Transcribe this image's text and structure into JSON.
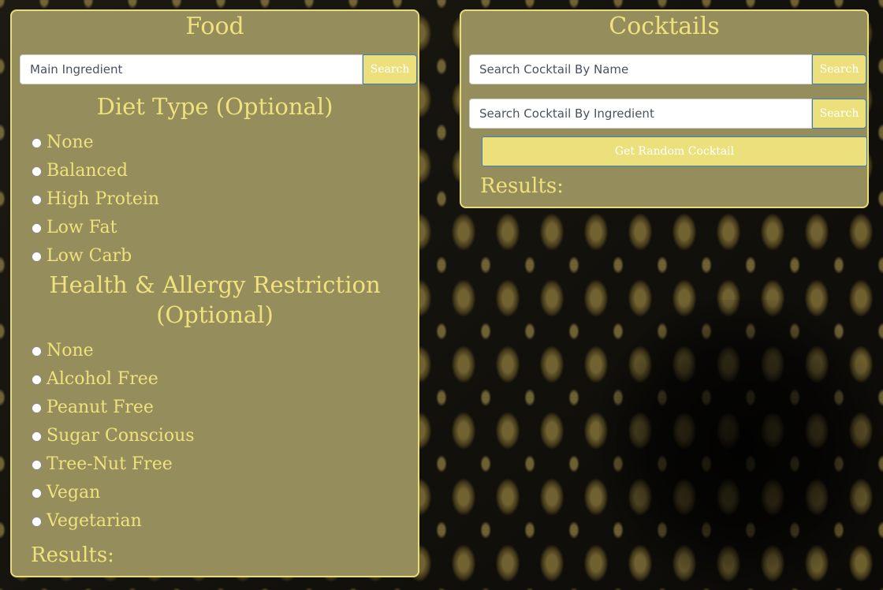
{
  "food": {
    "title": "Food",
    "search": {
      "placeholder": "Main Ingredient",
      "button_label": "Search"
    },
    "diet_heading": "Diet Type (Optional)",
    "diet_options": [
      "None",
      "Balanced",
      "High Protein",
      "Low Fat",
      "Low Carb"
    ],
    "health_heading_line1": "Health & Allergy Restriction",
    "health_heading_line2": "(Optional)",
    "health_options": [
      "None",
      "Alcohol Free",
      "Peanut Free",
      "Sugar Conscious",
      "Tree-Nut Free",
      "Vegan",
      "Vegetarian"
    ],
    "results_label": "Results:"
  },
  "cocktails": {
    "title": "Cocktails",
    "search_by_name": {
      "placeholder": "Search Cocktail By Name",
      "button_label": "Search"
    },
    "search_by_ingredient": {
      "placeholder": "Search Cocktail By Ingredient",
      "button_label": "Search"
    },
    "random_button_label": "Get Random Cocktail",
    "results_label": "Results:"
  },
  "colors": {
    "panel_background": "#958d5c",
    "accent_gold": "#efe27d",
    "button_background": "#ece07d",
    "button_border": "#3a7fb7"
  },
  "icons": {
    "radio": "radio-circle"
  }
}
